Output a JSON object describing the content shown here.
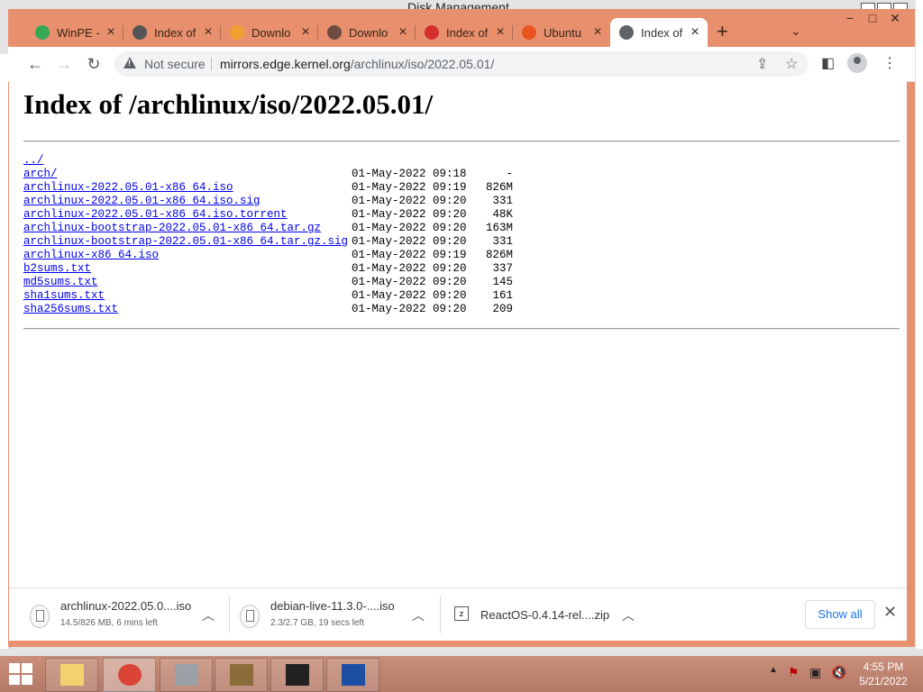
{
  "behind_window": {
    "title": "Disk Management"
  },
  "tabs": [
    {
      "label": "WinPE -",
      "icon": "google-drive-icon",
      "color": "#34a853"
    },
    {
      "label": "Index of",
      "icon": "site-icon",
      "color": "#555555"
    },
    {
      "label": "Downlo",
      "icon": "download-site-icon",
      "color": "#f0a030"
    },
    {
      "label": "Downlo",
      "icon": "download-icon",
      "color": "#6d4c41"
    },
    {
      "label": "Index of",
      "icon": "arch-icon",
      "color": "#d32f2f"
    },
    {
      "label": "Ubuntu",
      "icon": "ubuntu-icon",
      "color": "#e95420"
    },
    {
      "label": "Index of",
      "icon": "globe-icon",
      "color": "#5f6368"
    }
  ],
  "toolbar": {
    "security_text": "Not secure",
    "url_host": "mirrors.edge.kernel.org",
    "url_path": "/archlinux/iso/2022.05.01/"
  },
  "page": {
    "heading": "Index of /archlinux/iso/2022.05.01/",
    "entries": [
      {
        "name": "../",
        "date": "",
        "size": ""
      },
      {
        "name": "arch/",
        "date": "01-May-2022 09:18",
        "size": "-"
      },
      {
        "name": "archlinux-2022.05.01-x86_64.iso",
        "date": "01-May-2022 09:19",
        "size": "826M"
      },
      {
        "name": "archlinux-2022.05.01-x86_64.iso.sig",
        "date": "01-May-2022 09:20",
        "size": "331"
      },
      {
        "name": "archlinux-2022.05.01-x86_64.iso.torrent",
        "date": "01-May-2022 09:20",
        "size": "48K"
      },
      {
        "name": "archlinux-bootstrap-2022.05.01-x86_64.tar.gz",
        "date": "01-May-2022 09:20",
        "size": "163M"
      },
      {
        "name": "archlinux-bootstrap-2022.05.01-x86_64.tar.gz.sig",
        "date": "01-May-2022 09:20",
        "size": "331"
      },
      {
        "name": "archlinux-x86_64.iso",
        "date": "01-May-2022 09:19",
        "size": "826M"
      },
      {
        "name": "b2sums.txt",
        "date": "01-May-2022 09:20",
        "size": "337"
      },
      {
        "name": "md5sums.txt",
        "date": "01-May-2022 09:20",
        "size": "145"
      },
      {
        "name": "sha1sums.txt",
        "date": "01-May-2022 09:20",
        "size": "161"
      },
      {
        "name": "sha256sums.txt",
        "date": "01-May-2022 09:20",
        "size": "209"
      }
    ]
  },
  "downloads": {
    "items": [
      {
        "name": "archlinux-2022.05.0....iso",
        "status": "14.5/826 MB, 6 mins left"
      },
      {
        "name": "debian-live-11.3.0-....iso",
        "status": "2.3/2.7 GB, 19 secs left"
      },
      {
        "name": "ReactOS-0.4.14-rel....zip",
        "status": ""
      }
    ],
    "show_all": "Show all"
  },
  "taskbar": {
    "apps": [
      {
        "name": "file-explorer",
        "icon": "folder-icon"
      },
      {
        "name": "chrome",
        "icon": "chrome-icon"
      },
      {
        "name": "disk-management",
        "icon": "disk-icon"
      },
      {
        "name": "user-app",
        "icon": "user-icon"
      },
      {
        "name": "7zip",
        "icon": "7zip-icon"
      },
      {
        "name": "virtualbox",
        "icon": "virtualbox-icon"
      }
    ],
    "time": "4:55 PM",
    "date": "5/21/2022"
  },
  "colors": {
    "browser_frame": "#e8906e",
    "link": "#0000ee",
    "show_all": "#1a73e8"
  }
}
